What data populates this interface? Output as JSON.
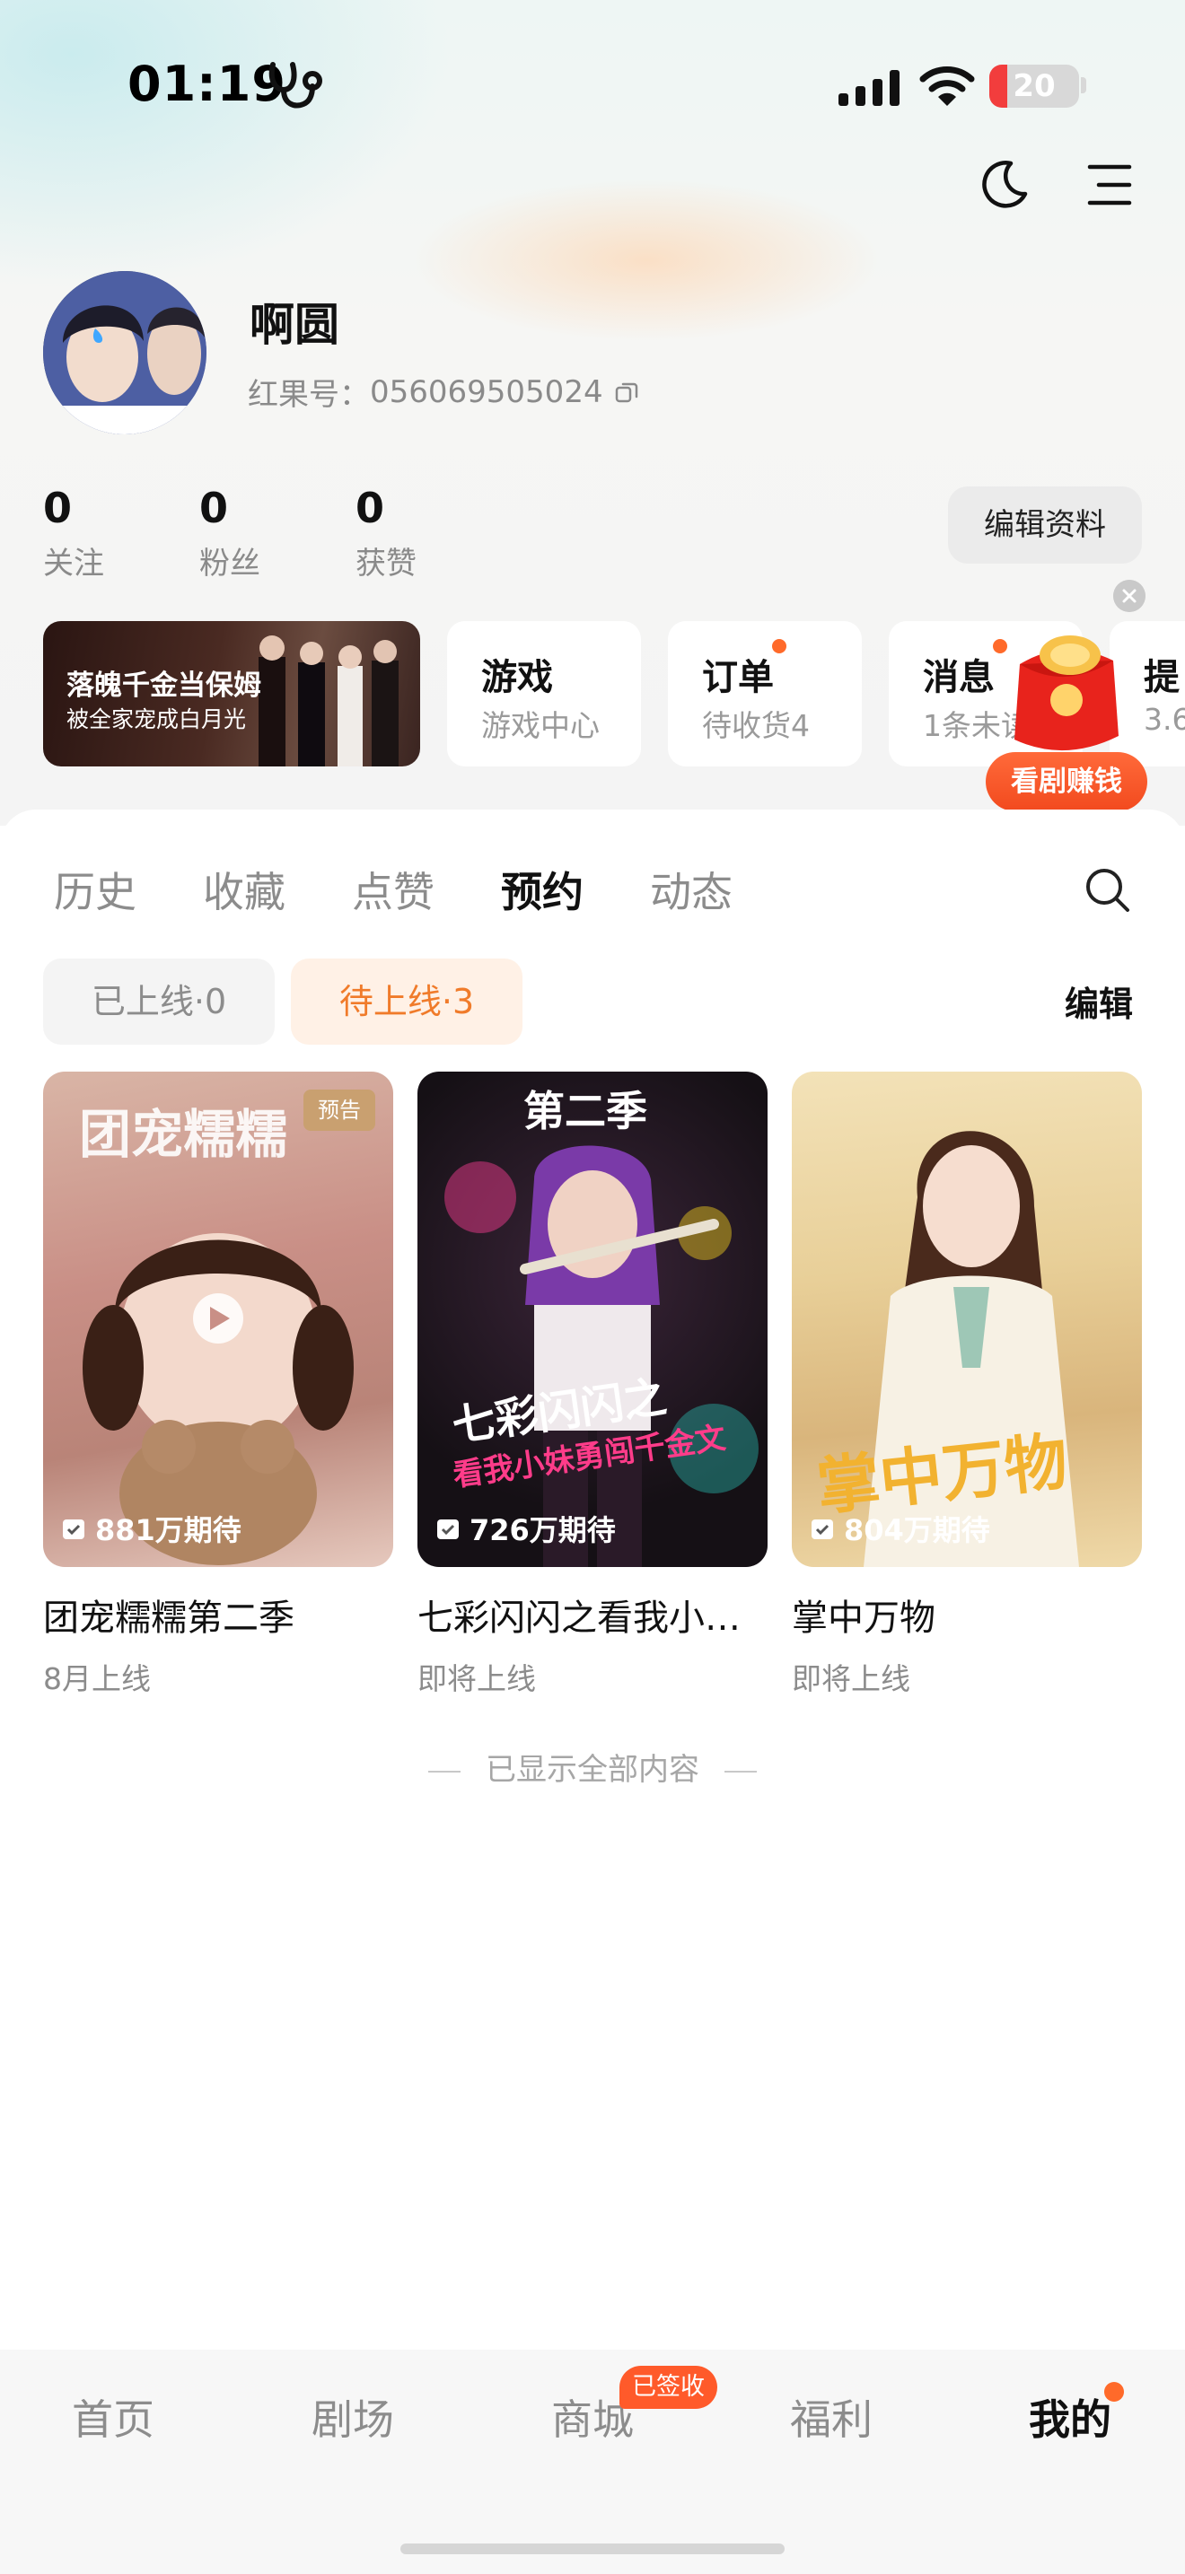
{
  "status_bar": {
    "time": "01:19",
    "battery": "20",
    "battery_level": 0.2
  },
  "profile": {
    "username": "啊圆",
    "uid_label": "红果号：",
    "uid": "056069505024",
    "stats": [
      {
        "value": "0",
        "label": "关注"
      },
      {
        "value": "0",
        "label": "粉丝"
      },
      {
        "value": "0",
        "label": "获赞"
      }
    ],
    "edit_button": "编辑资料"
  },
  "shortcuts": {
    "banner": {
      "title": "落魄千金当保姆",
      "subtitle": "被全家宠成白月光"
    },
    "cards": [
      {
        "title": "游戏",
        "subtitle": "游戏中心"
      },
      {
        "title": "订单",
        "subtitle": "待收货4"
      },
      {
        "title": "消息",
        "subtitle": "1条未读"
      },
      {
        "title": "提",
        "subtitle": "3.6"
      }
    ]
  },
  "floating_promo": {
    "label": "看剧赚钱"
  },
  "tabs": [
    "历史",
    "收藏",
    "点赞",
    "预约",
    "动态"
  ],
  "active_tab": "预约",
  "filters": {
    "online": "已上线·0",
    "upcoming": "待上线·3",
    "edit": "编辑"
  },
  "dramas": [
    {
      "title": "团宠糯糯第二季",
      "date": "8月上线",
      "count": "881万期待",
      "tag": "预告"
    },
    {
      "title": "七彩闪闪之看我小妹勇闯千金文",
      "date": "即将上线",
      "count": "726万期待"
    },
    {
      "title": "掌中万物",
      "date": "即将上线",
      "count": "804万期待"
    }
  ],
  "end_note": "已显示全部内容",
  "bottom_nav": {
    "items": [
      "首页",
      "剧场",
      "商城",
      "福利",
      "我的"
    ],
    "active": "我的",
    "mall_badge": "已签收"
  },
  "colors": {
    "accent": "#ff6a2a",
    "filter_active_text": "#f07b2a",
    "filter_active_bg": "#fff1e6"
  }
}
